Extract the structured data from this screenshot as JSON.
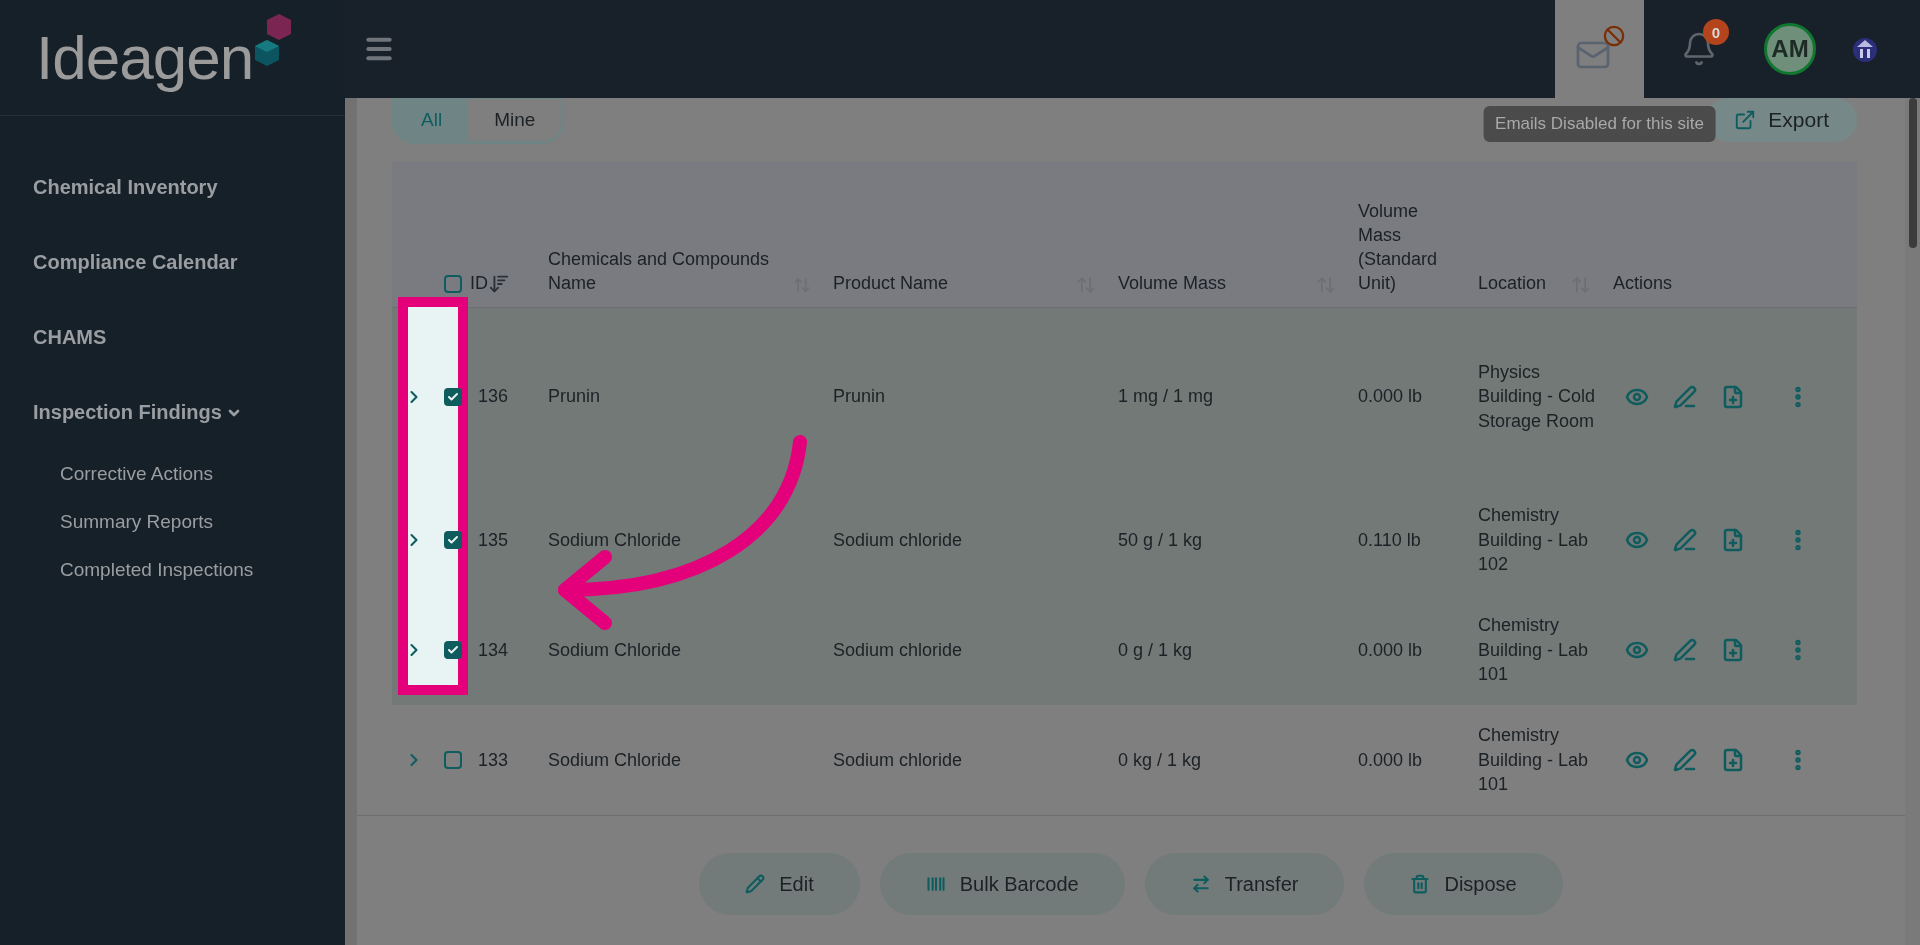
{
  "logo": {
    "text": "Ideagen"
  },
  "sidebar": {
    "items": [
      {
        "label": "Chemical Inventory"
      },
      {
        "label": "Compliance Calendar"
      },
      {
        "label": "CHAMS"
      },
      {
        "label": "Inspection Findings",
        "expanded": true,
        "children": [
          {
            "label": "Corrective Actions"
          },
          {
            "label": "Summary Reports"
          },
          {
            "label": "Completed Inspections"
          }
        ]
      }
    ]
  },
  "topbar": {
    "email_tooltip": "Emails Disabled for this site",
    "notification_count": "0",
    "avatar": "AM"
  },
  "filter_tabs": [
    {
      "label": "All",
      "selected": true
    },
    {
      "label": "Mine",
      "selected": false
    }
  ],
  "export_button": "Export",
  "table": {
    "select_all_checked": false,
    "columns": [
      {
        "label": "ID",
        "kind": "sorted"
      },
      {
        "label": "Chemicals and Compounds Name",
        "kind": "sortable"
      },
      {
        "label": "Product Name",
        "kind": "sortable"
      },
      {
        "label": "Volume Mass",
        "kind": "sortable"
      },
      {
        "label": "Volume Mass (Standard Unit)",
        "kind": "plain"
      },
      {
        "label": "Location",
        "kind": "sortable"
      },
      {
        "label": "Actions",
        "kind": "plain"
      }
    ],
    "rows": [
      {
        "id": "136",
        "name": "Prunin",
        "product": "Prunin",
        "volume_mass": "1 mg / 1 mg",
        "standard_unit": "0.000 lb",
        "location": "Physics Building - Cold Storage Room",
        "checked": true
      },
      {
        "id": "135",
        "name": "Sodium Chloride",
        "product": "Sodium chloride",
        "volume_mass": "50 g / 1 kg",
        "standard_unit": "0.110 lb",
        "location": "Chemistry Building - Lab 102",
        "checked": true
      },
      {
        "id": "134",
        "name": "Sodium Chloride",
        "product": "Sodium chloride",
        "volume_mass": "0 g / 1 kg",
        "standard_unit": "0.000 lb",
        "location": "Chemistry Building - Lab 101",
        "checked": true
      },
      {
        "id": "133",
        "name": "Sodium Chloride",
        "product": "Sodium chloride",
        "volume_mass": "0 kg / 1 kg",
        "standard_unit": "0.000 lb",
        "location": "Chemistry Building - Lab 101",
        "checked": false
      }
    ]
  },
  "bulk_actions": [
    {
      "label": "Edit",
      "kind": "edit"
    },
    {
      "label": "Bulk Barcode",
      "kind": "barcode"
    },
    {
      "label": "Transfer",
      "kind": "transfer"
    },
    {
      "label": "Dispose",
      "kind": "dispose"
    }
  ]
}
